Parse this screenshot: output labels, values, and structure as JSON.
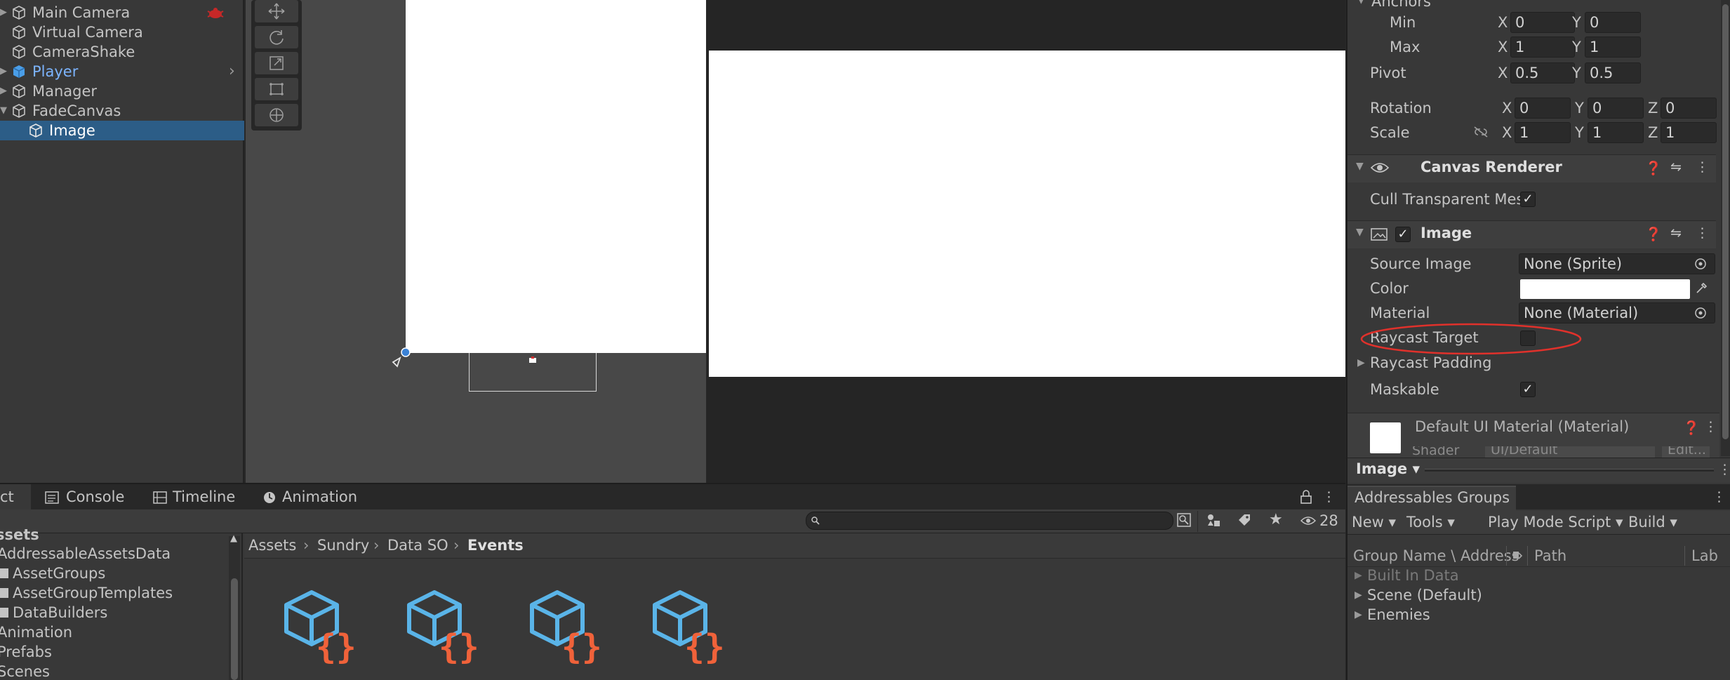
{
  "hierarchy": {
    "items": [
      {
        "label": "Main Camera"
      },
      {
        "label": "Virtual Camera"
      },
      {
        "label": "CameraShake"
      },
      {
        "label": "Player"
      },
      {
        "label": "Manager"
      },
      {
        "label": "FadeCanvas"
      },
      {
        "label": "Image"
      }
    ]
  },
  "inspector": {
    "anchors_label": "Anchors",
    "min_label": "Min",
    "max_label": "Max",
    "pivot_label": "Pivot",
    "rotation_label": "Rotation",
    "scale_label": "Scale",
    "x": "X",
    "y": "Y",
    "z": "Z",
    "anchor_min": {
      "x": "0",
      "y": "0"
    },
    "anchor_max": {
      "x": "1",
      "y": "1"
    },
    "pivot": {
      "x": "0.5",
      "y": "0.5"
    },
    "rotation": {
      "x": "0",
      "y": "0",
      "z": "0"
    },
    "scale": {
      "x": "1",
      "y": "1",
      "z": "1"
    },
    "canvas_renderer": {
      "title": "Canvas Renderer",
      "cull_label": "Cull Transparent Mes",
      "cull_checked": "✓"
    },
    "image": {
      "title": "Image",
      "enabled": "✓",
      "source_image_label": "Source Image",
      "source_image_value": "None (Sprite)",
      "color_label": "Color",
      "color_value": "#ffffff",
      "material_label": "Material",
      "material_value": "None (Material)",
      "raycast_target_label": "Raycast Target",
      "raycast_padding_label": "Raycast Padding",
      "maskable_label": "Maskable",
      "maskable_checked": "✓"
    },
    "default_material": {
      "title": "Default UI Material (Material)",
      "shader_label": "Shader",
      "shader_value": "UI/Default",
      "edit_label": "Edit..."
    },
    "preview_label": "Image"
  },
  "bottom_tabs": [
    {
      "label": "ct"
    },
    {
      "label": "Console"
    },
    {
      "label": "Timeline"
    },
    {
      "label": "Animation"
    }
  ],
  "project": {
    "hidden_count": "28",
    "tree": [
      {
        "label": "ssets"
      },
      {
        "label": "AddressableAssetsData"
      },
      {
        "label": "AssetGroups"
      },
      {
        "label": "AssetGroupTemplates"
      },
      {
        "label": "DataBuilders"
      },
      {
        "label": "Animation"
      },
      {
        "label": "Prefabs"
      },
      {
        "label": "Scenes"
      }
    ],
    "breadcrumb": [
      "Assets",
      "Sundry",
      "Data SO",
      "Events"
    ]
  },
  "addressables": {
    "tab_label": "Addressables Groups",
    "toolbar": {
      "new_label": "New",
      "tools_label": "Tools",
      "play_mode_label": "Play Mode Script",
      "build_label": "Build"
    },
    "columns": {
      "group_name": "Group Name \\ Address",
      "path": "Path",
      "labels": "Lab"
    },
    "groups": [
      {
        "label": "Built In Data"
      },
      {
        "label": "Scene (Default)"
      },
      {
        "label": "Enemies"
      }
    ]
  },
  "colors": {
    "selection": "#2c5d87",
    "accent_blue": "#7cb4ff",
    "highlight_ring": "#e0312b",
    "asset_icon_blue": "#5ab4e8",
    "asset_icon_orange": "#f0623a"
  }
}
